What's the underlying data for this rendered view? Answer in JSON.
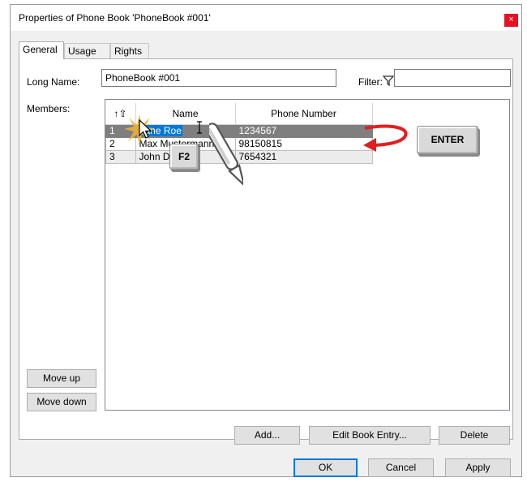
{
  "window": {
    "title": "Properties of Phone Book 'PhoneBook #001'",
    "close_glyph": "×"
  },
  "tabs": [
    {
      "label": "General"
    },
    {
      "label": "Usage"
    },
    {
      "label": "Rights"
    }
  ],
  "form": {
    "long_name_label": "Long Name:",
    "long_name_value": "PhoneBook #001",
    "filter_label": "Filter:",
    "filter_value": "",
    "members_label": "Members:"
  },
  "members_table": {
    "sort_glyph": "↑⇧",
    "columns": [
      "Name",
      "Phone Number"
    ],
    "rows": [
      {
        "index": "1",
        "name": "Jane Roe",
        "phone": "1234567"
      },
      {
        "index": "2",
        "name": "Max Mustermann",
        "phone": "98150815"
      },
      {
        "index": "3",
        "name": "John Doe",
        "phone": "7654321"
      }
    ]
  },
  "buttons": {
    "move_up": "Move up",
    "move_down": "Move down",
    "add": "Add...",
    "edit": "Edit Book Entry...",
    "delete": "Delete",
    "ok": "OK",
    "cancel": "Cancel",
    "apply": "Apply"
  },
  "overlays": {
    "key_f2": "F2",
    "key_enter": "ENTER"
  },
  "icons": [
    "filter-icon",
    "mouse-pointer-icon",
    "text-cursor-icon",
    "pen-icon",
    "return-arrow-icon",
    "sort-arrow-icon"
  ],
  "colors": {
    "selection": "#7f7f7f",
    "edit_highlight": "#0078d7",
    "arrow": "#e02020",
    "close": "#e81123"
  }
}
